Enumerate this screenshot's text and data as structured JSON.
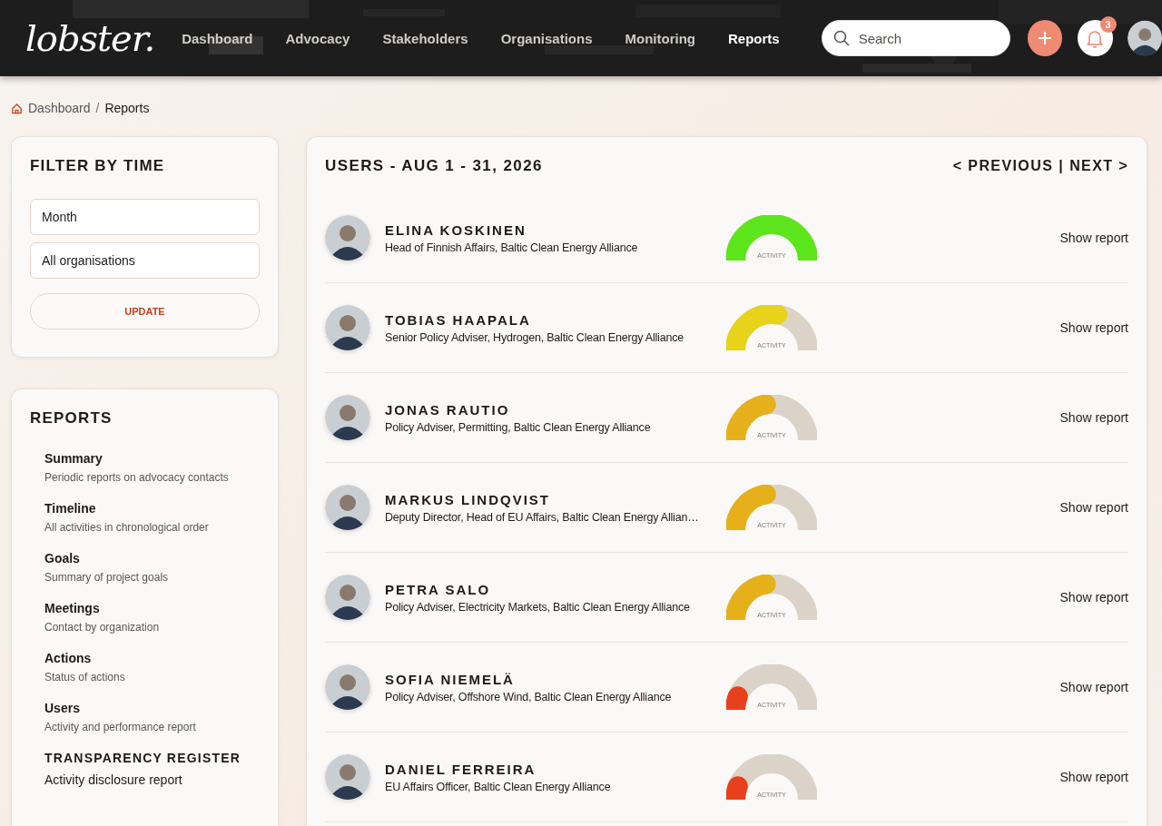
{
  "header": {
    "logo": "lobster.",
    "nav": [
      {
        "label": "Dashboard",
        "selected": false
      },
      {
        "label": "Advocacy",
        "selected": false
      },
      {
        "label": "Stakeholders",
        "selected": false
      },
      {
        "label": "Organisations",
        "selected": false
      },
      {
        "label": "Monitoring",
        "selected": false
      },
      {
        "label": "Reports",
        "selected": true
      }
    ],
    "search": {
      "placeholder": "Search"
    },
    "notifications": "3"
  },
  "breadcrumb": [
    "Dashboard",
    "/",
    "Reports"
  ],
  "filter": {
    "title": "FILTER BY TIME",
    "fields": [
      "Month",
      "All organisations"
    ],
    "button": "UPDATE"
  },
  "reports": {
    "title": "REPORTS",
    "items": [
      {
        "title": "Summary",
        "description": "Periodic reports on advocacy contacts"
      },
      {
        "title": "Timeline",
        "description": "All activities in chronological order"
      },
      {
        "title": "Goals",
        "description": "Summary of project goals"
      },
      {
        "title": "Meetings",
        "description": "Contact by organization"
      },
      {
        "title": "Actions",
        "description": "Status of actions"
      },
      {
        "title": "Users",
        "description": "Activity and performance report"
      }
    ],
    "register": {
      "title": "TRANSPARENCY REGISTER",
      "description": "Activity disclosure report"
    }
  },
  "users_panel": {
    "title": "USERS - AUG 1 - 31, 2026",
    "previous": "< PREVIOUS",
    "separator": "|",
    "next": "NEXT >",
    "users": [
      {
        "name": "ELINA KOSKINEN",
        "role": "Head of Finnish Affairs, Baltic Clean Energy Alliance",
        "level": 1,
        "color": "#5de51c",
        "gauge_label": "ACTIVITY",
        "link": "Show report"
      },
      {
        "name": "TOBIAS HAAPALA",
        "role": "Senior Policy Adviser, Hydrogen, Baltic Clean Energy Alliance",
        "level": 0.55,
        "color": "#e6d31a",
        "gauge_label": "ACTIVITY",
        "link": "Show report"
      },
      {
        "name": "JONAS RAUTIO",
        "role": "Policy Adviser, Permitting, Baltic Clean Energy Alliance",
        "level": 0.45,
        "color": "#e6b01a",
        "gauge_label": "ACTIVITY",
        "link": "Show report"
      },
      {
        "name": "MARKUS LINDQVIST",
        "role": "Deputy Director, Head of EU Affairs, Baltic Clean Energy Allian…",
        "level": 0.45,
        "color": "#e6b01a",
        "gauge_label": "ACTIVITY",
        "link": "Show report"
      },
      {
        "name": "PETRA SALO",
        "role": "Policy Adviser, Electricity Markets, Baltic Clean Energy Alliance",
        "level": 0.45,
        "color": "#e6b01a",
        "gauge_label": "ACTIVITY",
        "link": "Show report"
      },
      {
        "name": "SOFIA NIEMELÄ",
        "role": "Policy Adviser, Offshore Wind, Baltic Clean Energy Alliance",
        "level": 0.12,
        "color": "#e8401c",
        "gauge_label": "ACTIVITY",
        "link": "Show report"
      },
      {
        "name": "DANIEL FERREIRA",
        "role": "EU Affairs Officer, Baltic Clean Energy Alliance",
        "level": 0.12,
        "color": "#e8401c",
        "gauge_label": "ACTIVITY",
        "link": "Show report"
      }
    ]
  }
}
